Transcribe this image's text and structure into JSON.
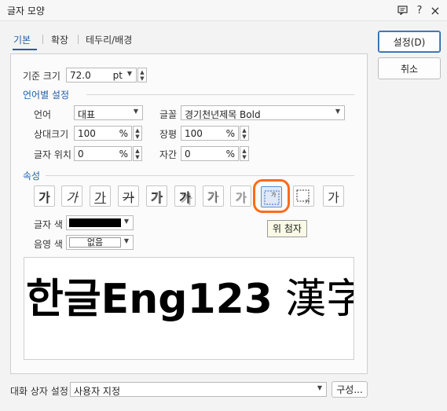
{
  "window": {
    "title": "글자 모양",
    "icons": [
      "chat-icon",
      "help-icon",
      "close-icon"
    ],
    "help_glyph": "?",
    "close_glyph": "×"
  },
  "tabs": [
    {
      "label": "기본",
      "active": true
    },
    {
      "label": "확장",
      "active": false
    },
    {
      "label": "테두리/배경",
      "active": false
    }
  ],
  "base_size": {
    "label": "기준 크기",
    "value": "72.0",
    "unit": "pt"
  },
  "lang_section": {
    "title": "언어별 설정",
    "language": {
      "label": "언어",
      "value": "대표"
    },
    "font": {
      "label": "글꼴",
      "value": "경기천년제목 Bold"
    },
    "relative_size": {
      "label": "상대크기",
      "value": "100",
      "unit": "%"
    },
    "width_ratio": {
      "label": "장평",
      "value": "100",
      "unit": "%"
    },
    "char_position": {
      "label": "글자 위치",
      "value": "0",
      "unit": "%"
    },
    "char_spacing": {
      "label": "자간",
      "value": "0",
      "unit": "%"
    }
  },
  "attributes": {
    "title": "속성",
    "buttons": [
      {
        "name": "bold-button",
        "glyph": "가"
      },
      {
        "name": "italic-button",
        "glyph": "가"
      },
      {
        "name": "underline-button",
        "glyph": "가"
      },
      {
        "name": "strikethrough-button",
        "glyph": "가"
      },
      {
        "name": "outline-button",
        "glyph": "가"
      },
      {
        "name": "shadow-button",
        "glyph": "가"
      },
      {
        "name": "emboss-button",
        "glyph": "가"
      },
      {
        "name": "engrave-button",
        "glyph": "가"
      },
      {
        "name": "superscript-button",
        "glyph": "가",
        "active": true
      },
      {
        "name": "subscript-button",
        "glyph": "가"
      },
      {
        "name": "normal-button",
        "glyph": "가"
      }
    ],
    "tooltip": "위 첨자"
  },
  "text_color": {
    "label": "글자 색",
    "value": "#000000"
  },
  "shade_color": {
    "label": "음영 색",
    "value": "없음"
  },
  "preview": {
    "bold_text": "한글Eng123",
    "light_text": "漢字"
  },
  "buttons": {
    "ok": "설정(D)",
    "cancel": "취소",
    "configure": "구성..."
  },
  "dialog_settings": {
    "label": "대화 상자 설정",
    "value": "사용자 지정"
  },
  "colors": {
    "accent": "#1f5fa8",
    "highlight": "#ff6a1a"
  }
}
